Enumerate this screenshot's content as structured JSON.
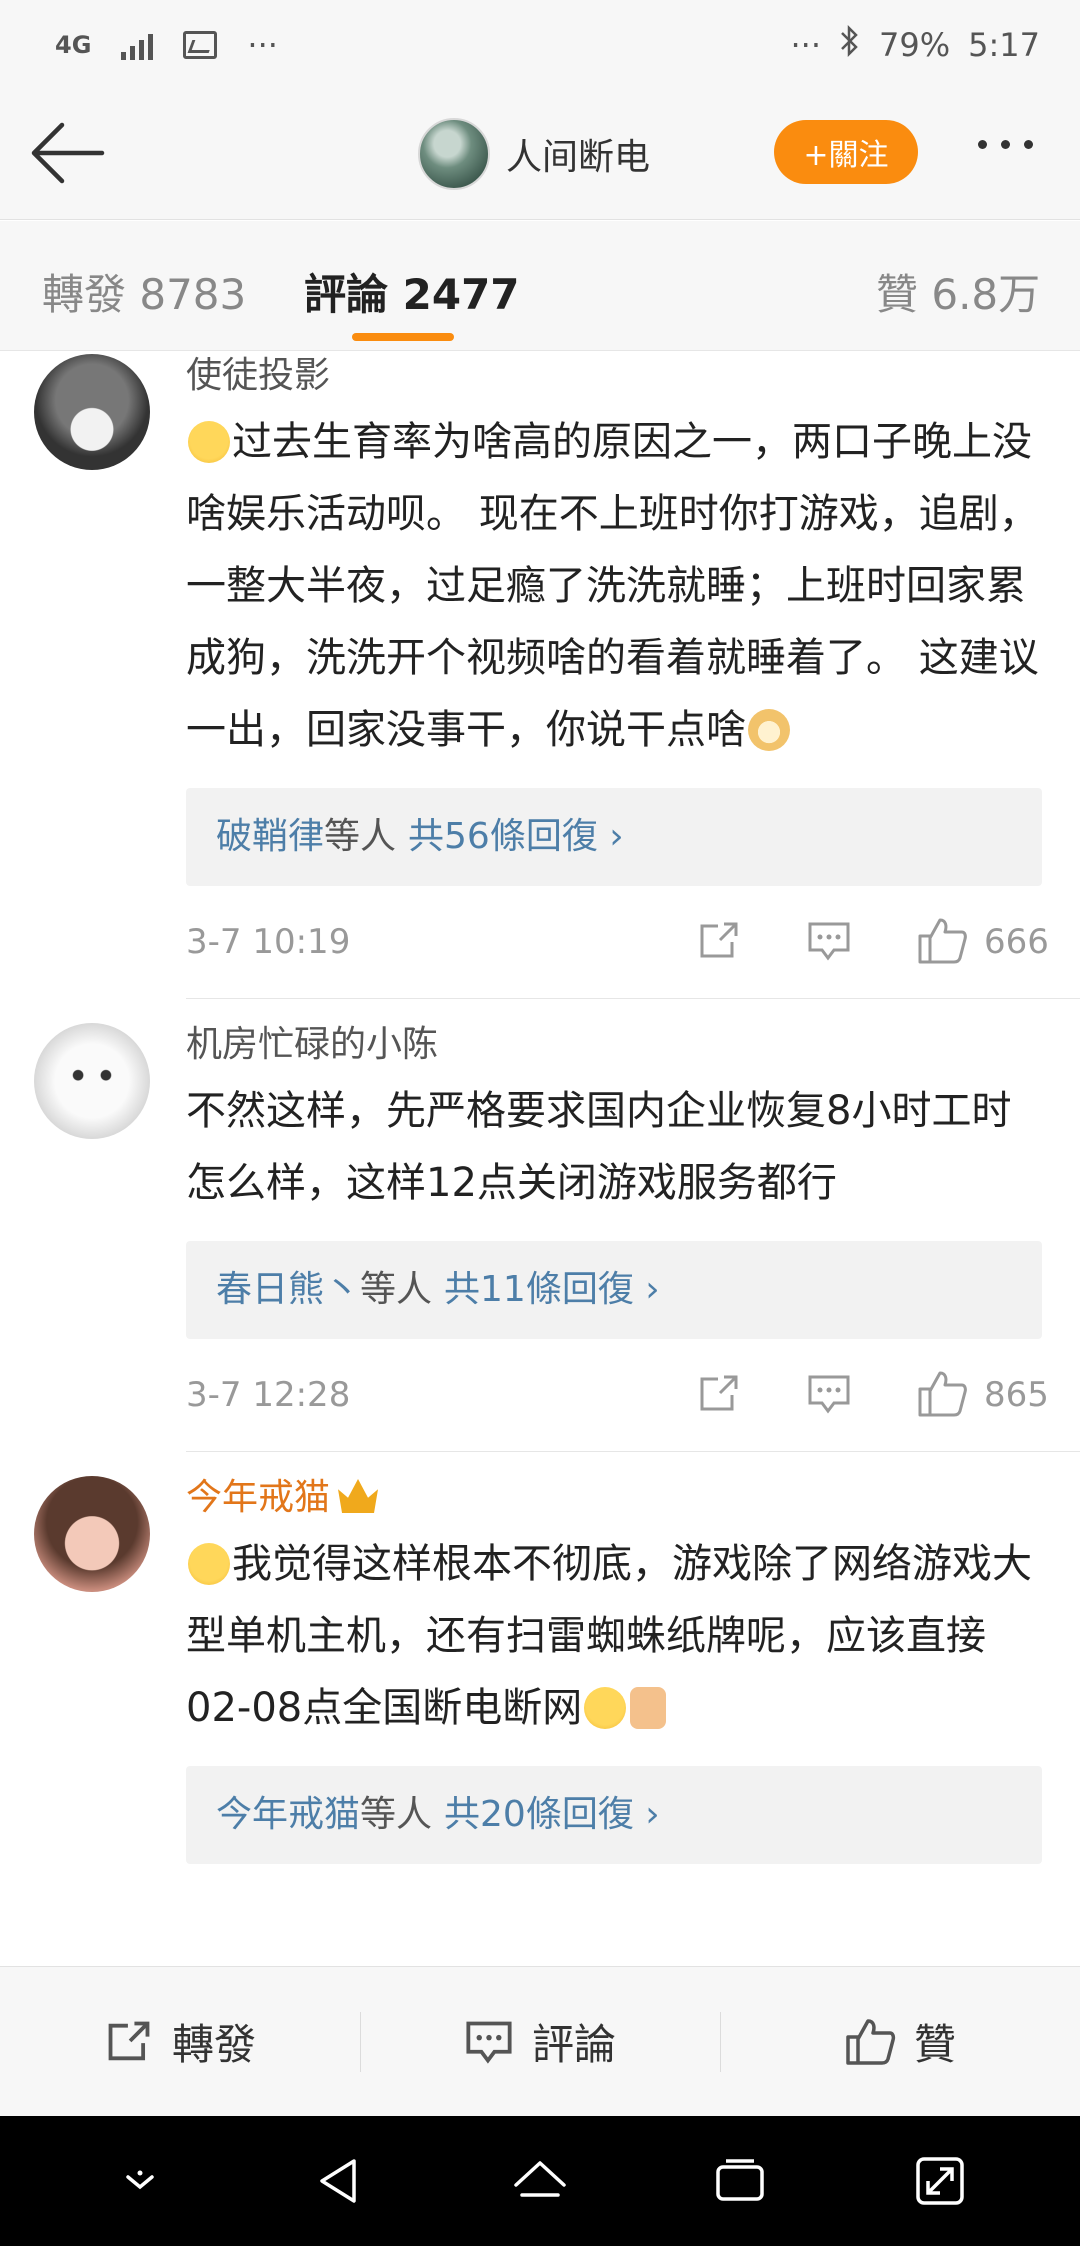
{
  "status_bar": {
    "network": "4G",
    "dots_left": "···",
    "dots_right": "···",
    "battery": "79%",
    "time": "5:17"
  },
  "header": {
    "title": "人间断电",
    "follow_label": "+關注"
  },
  "tabs": {
    "repost": "轉發 8783",
    "comments": "評論 2477",
    "likes": "贊 6.8万"
  },
  "comments": [
    {
      "name": "使徒投影",
      "text_1": "过去生育率为啥高的原因之一，两口子晚上没啥娱乐活动呗。 现在不上班时你打游戏，追剧，一整大半夜，过足瘾了洗洗就睡；上班时回家累成狗，洗洗开个视频啥的看着就睡着了。 这建议一出，回家没事干，你说干点啥",
      "replies_who": "破鞘律",
      "replies_mid": "等人",
      "replies_count": "共56條回復 ›",
      "time": "3-7 10:19",
      "likes": "666"
    },
    {
      "name": "机房忙碌的小陈",
      "text_1": "不然这样，先严格要求国内企业恢复8小时工时怎么样，这样12点关闭游戏服务都行",
      "replies_who": "春日熊丶",
      "replies_mid": "等人",
      "replies_count": "共11條回復 ›",
      "time": "3-7 12:28",
      "likes": "865"
    },
    {
      "name": "今年戒猫",
      "text_1": "我觉得这样根本不彻底，游戏除了网络游戏大型单机主机，还有扫雷蜘蛛纸牌呢，应该直接02-08点全国断电断网",
      "replies_who": "今年戒猫",
      "replies_mid": "等人",
      "replies_count": "共20條回復 ›"
    }
  ],
  "action_bar": {
    "repost": "轉發",
    "comment": "評論",
    "like": "贊"
  },
  "colors": {
    "accent": "#fa8c0f",
    "link": "#4d7ea8",
    "vip_name": "#e2761a"
  }
}
